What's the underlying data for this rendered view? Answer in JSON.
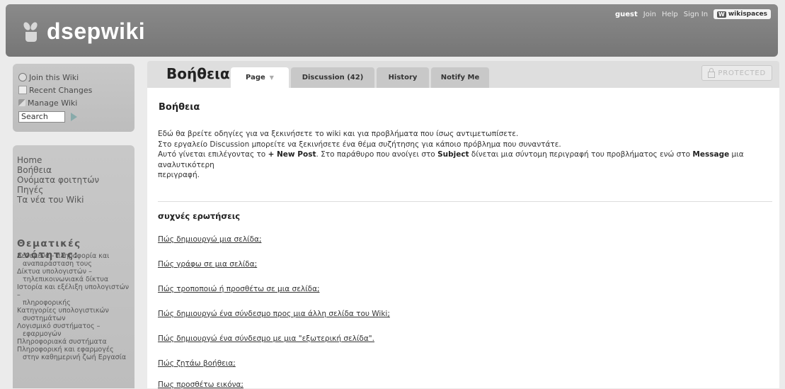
{
  "header": {
    "site_title": "dsepwiki",
    "user": "guest",
    "links": [
      "Join",
      "Help",
      "Sign In"
    ],
    "wikispaces_label": "wikispaces"
  },
  "sidebar": {
    "actions": [
      {
        "label": "Join this Wiki",
        "icon": "join-icon"
      },
      {
        "label": "Recent Changes",
        "icon": "recent-changes-icon"
      },
      {
        "label": "Manage Wiki",
        "icon": "manage-icon"
      }
    ],
    "search_value": "Search",
    "nav": [
      "Home",
      "Βοήθεια",
      "Ονόματα φοιτητών",
      "Πηγές",
      "Τα νέα του Wiki"
    ],
    "themes_title": "Θεματικές ενότητες:",
    "themes": [
      [
        "Δεδομένα - πληροφορία και",
        "αναπαράσταση τους"
      ],
      [
        "Δίκτυα υπολογιστών –",
        "τηλεπικοινωνιακά δίκτυα"
      ],
      [
        "Ιστορία και εξέλιξη υπολογιστών –",
        "πληροφορικής"
      ],
      [
        "Κατηγορίες υπολογιστικών",
        "συστημάτων"
      ],
      [
        "Λογισμικό συστήματος –",
        "εφαρμογών"
      ],
      [
        "Πληροφοριακά συστήματα"
      ],
      [
        "Πληροφορική και εφαρμογές",
        "στην καθημερινή ζωή Εργασία"
      ]
    ]
  },
  "page": {
    "heading": "Βοήθεια",
    "tabs": [
      "Page",
      "Discussion (42)",
      "History",
      "Notify Me"
    ],
    "protected_label": "PROTECTED",
    "content_title": "Βοήθεια",
    "lines": [
      "Εδώ θα βρείτε οδηγίες για να ξεκινήσετε το wiki και για προβλήματα που ίσως αντιμετωπίσετε.",
      "Στο εργαλείο Discussion μπορείτε να ξεκινήσετε ένα θέμα συζήτησης για κάποιο πρόβλημα που συναντάτε."
    ],
    "line3": {
      "t1": "Αυτό γίνεται επιλέγοντας το ",
      "b1": "+ New Post",
      "t2": ". Στο παράθυρο που ανοίγει στο ",
      "b2": "Subject",
      "t3": " δίνεται μια σύντομη περιγραφή του προβλήματος ενώ στο ",
      "b3": "Message",
      "t4": " μια αναλυτικότερη",
      "t5": "περιγραφή."
    },
    "faq_title": "συχνές ερωτήσεις",
    "faq": [
      "Πώς δημιουργώ μια σελίδα;",
      "Πώς γράφω σε μια σελίδα;",
      "Πώς τροποποιώ ή προσθέτω σε μια σελίδα;",
      "Πώς δημιουργώ ένα σύνδεσμο προς μια άλλη σελίδα του Wiki;",
      "Πώς δημιουργώ ένα σύνδεσμο με μια \"εξωτερική σελίδα\".",
      "Πώς ζητάω βοήθεια;",
      "Πως προσθέτω εικόνα;"
    ]
  }
}
